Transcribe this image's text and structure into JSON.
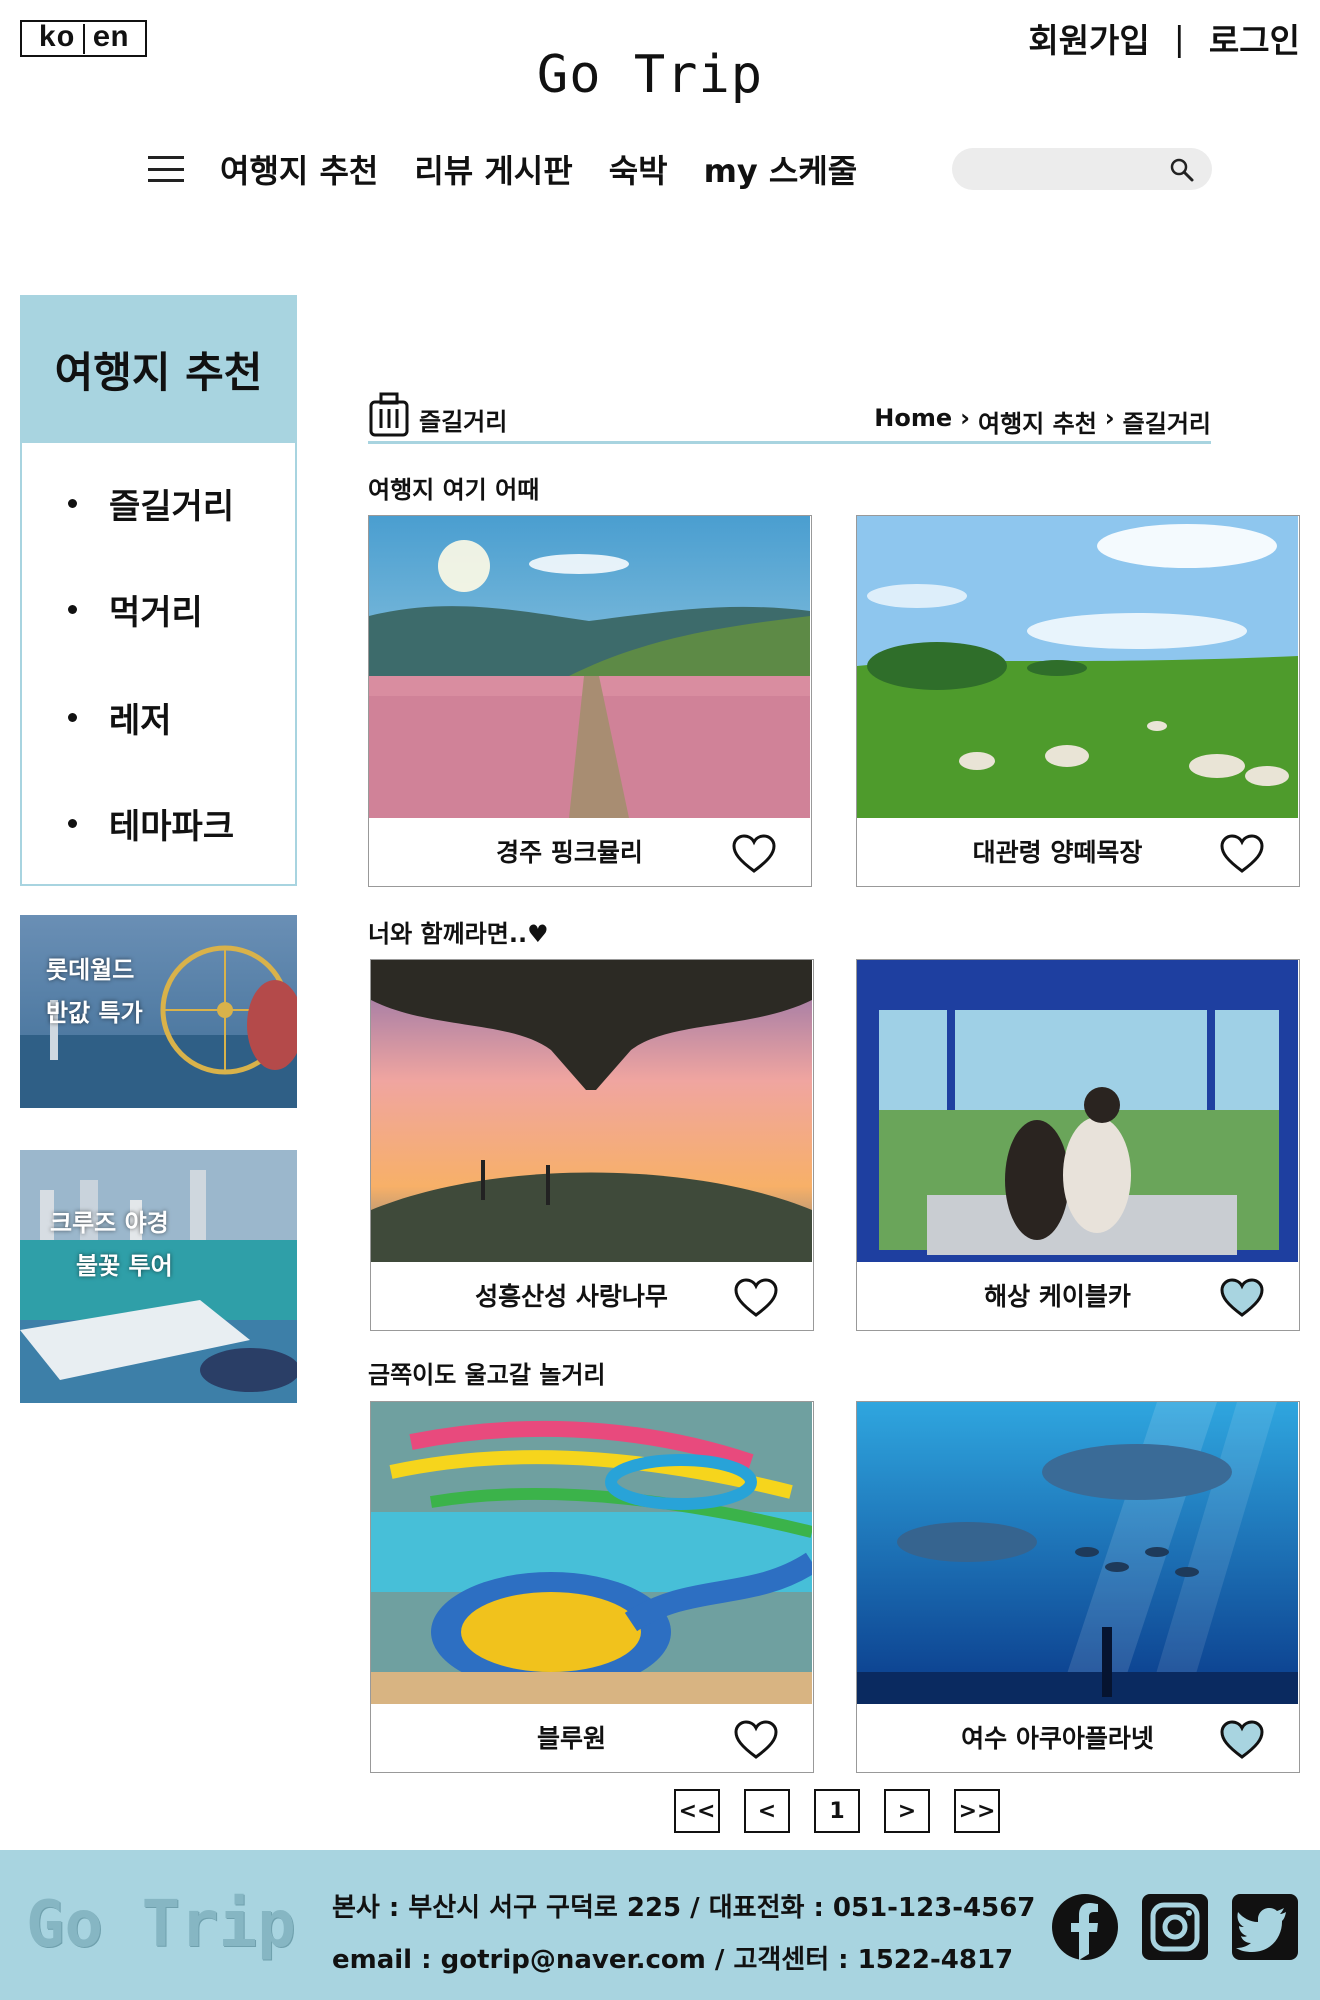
{
  "header": {
    "lang": [
      "ko",
      "en"
    ],
    "logo": "Go Trip",
    "signup": "회원가입",
    "divider": "|",
    "login": "로그인"
  },
  "nav": {
    "items": [
      "여행지 추천",
      "리뷰 게시판",
      "숙박",
      "my 스케줄"
    ],
    "search_placeholder": ""
  },
  "sidebar": {
    "title": "여행지 추천",
    "items": [
      "즐길거리",
      "먹거리",
      "레저",
      "테마파크"
    ],
    "banners": [
      {
        "lines": [
          "롯데월드",
          "반값 특가"
        ]
      },
      {
        "lines": [
          "크루즈 야경",
          "불꽃 투어"
        ]
      }
    ]
  },
  "main": {
    "section_title": "즐길거리",
    "breadcrumb": [
      "Home",
      "여행지 추천",
      "즐길거리"
    ],
    "groups": [
      {
        "title": "여행지 여기 어때",
        "cards": [
          {
            "name": "경주 핑크뮬리",
            "icon": "heart-icon"
          },
          {
            "name": "대관령 양떼목장",
            "icon": "heart-icon"
          }
        ]
      },
      {
        "title": "너와  함께라면..♥",
        "cards": [
          {
            "name": "성흥산성 사랑나무",
            "icon": "heart-icon"
          },
          {
            "name": "해상 케이블카",
            "icon": "heart-icon",
            "filled": true
          }
        ]
      },
      {
        "title": "금쪽이도 울고갈 놀거리",
        "cards": [
          {
            "name": "블루원",
            "icon": "heart-icon"
          },
          {
            "name": "여수 아쿠아플라넷",
            "icon": "heart-icon",
            "filled": true
          }
        ]
      }
    ],
    "pagination": {
      "first": "<<",
      "prev": "<",
      "current": "1",
      "next": ">",
      "last": ">>"
    }
  },
  "footer": {
    "logo": "Go Trip",
    "line1": "본사 : 부산시 서구 구덕로 225 / 대표전화 : 051-123-4567",
    "line2": "email : gotrip@naver.com / 고객센터 : 1522-4817",
    "social": [
      "facebook-icon",
      "instagram-icon",
      "twitter-icon"
    ]
  },
  "colors": {
    "accent": "#a8d4e0",
    "heart_fill": "#a8d4e0"
  }
}
